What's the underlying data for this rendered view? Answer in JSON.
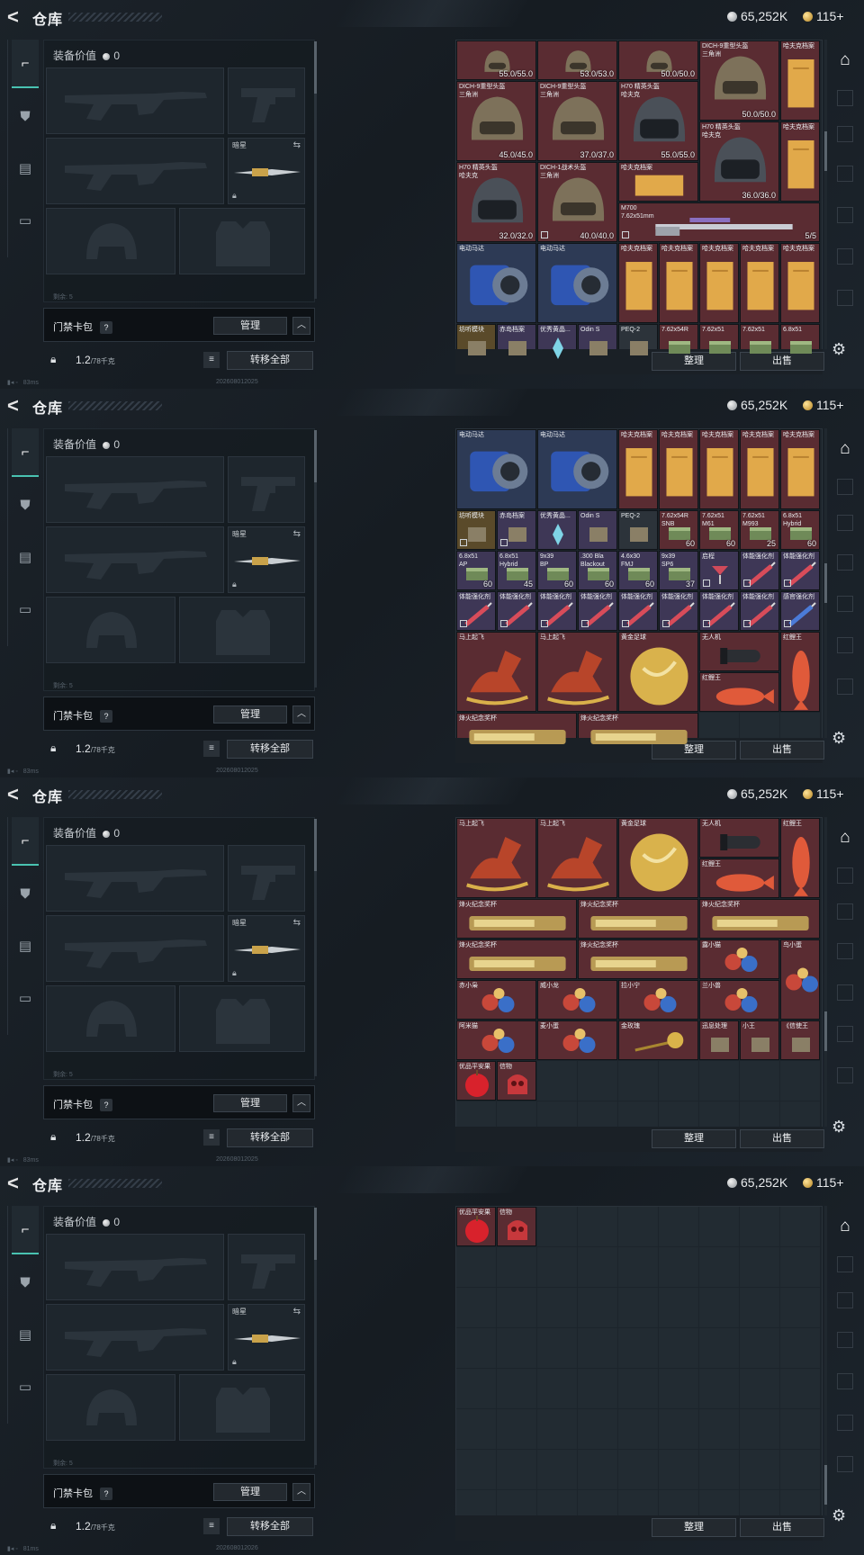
{
  "header": {
    "back_icon": "back-arrow-icon",
    "title": "仓库",
    "silver": "65,252K",
    "gold": "115+"
  },
  "sidebar_tabs": [
    {
      "icon": "gun-icon",
      "glyph": "⌐",
      "active": true
    },
    {
      "icon": "armor-icon",
      "glyph": "⛊",
      "active": false
    },
    {
      "icon": "clipboard-icon",
      "glyph": "▤",
      "active": false
    },
    {
      "icon": "briefcase-icon",
      "glyph": "▭",
      "active": false
    }
  ],
  "equipment": {
    "value_label": "装备价值",
    "value": "0",
    "melee_label": "暗星",
    "row_hint": "剩余: 5"
  },
  "bag": {
    "name": "门禁卡包",
    "help": "?",
    "manage": "管理",
    "caret": "^"
  },
  "footer": {
    "weight": "1.2",
    "weight_max": "/78千克",
    "list_icon": "≡",
    "move_all": "转移全部",
    "sort": "整理",
    "sell": "出售"
  },
  "status_panels": [
    {
      "ping": "83ms",
      "build": "202608012025"
    },
    {
      "ping": "83ms",
      "build": "202608012025"
    },
    {
      "ping": "83ms",
      "build": "202608012025"
    },
    {
      "ping": "81ms",
      "build": "202608012026"
    }
  ],
  "scroll_positions": [
    0.34,
    0.5,
    0.72,
    0.96
  ],
  "stash_views": [
    [
      {
        "c": 1,
        "r": 1,
        "w": 2,
        "h": 1,
        "name": "",
        "qty": "55.0/55.0",
        "rar": "r-red",
        "icon": "helmet"
      },
      {
        "c": 3,
        "r": 1,
        "w": 2,
        "h": 1,
        "name": "",
        "qty": "53.0/53.0",
        "rar": "r-red",
        "icon": "helmet"
      },
      {
        "c": 5,
        "r": 1,
        "w": 2,
        "h": 1,
        "name": "",
        "qty": "50.0/50.0",
        "rar": "r-red",
        "icon": "helmet"
      },
      {
        "c": 7,
        "r": 1,
        "w": 2,
        "h": 2,
        "name": "DICH-9重型头盔\n三角洲",
        "qty": "50.0/50.0",
        "rar": "r-red",
        "icon": "helmet"
      },
      {
        "c": 9,
        "r": 1,
        "w": 1,
        "h": 2,
        "name": "哈夫克档案",
        "qty": "",
        "rar": "r-red",
        "icon": "doc"
      },
      {
        "c": 1,
        "r": 2,
        "w": 2,
        "h": 2,
        "name": "DICH-9重型头盔\n三角洲",
        "qty": "45.0/45.0",
        "rar": "r-red",
        "icon": "helmet"
      },
      {
        "c": 3,
        "r": 2,
        "w": 2,
        "h": 2,
        "name": "DICH-9重型头盔\n三角洲",
        "qty": "37.0/37.0",
        "rar": "r-red",
        "icon": "helmet"
      },
      {
        "c": 5,
        "r": 2,
        "w": 2,
        "h": 2,
        "name": "H70 精英头盔\n哈夫克",
        "qty": "55.0/55.0",
        "rar": "r-red",
        "icon": "helmet-dark"
      },
      {
        "c": 7,
        "r": 3,
        "w": 2,
        "h": 2,
        "name": "H70 精英头盔\n哈夫克",
        "qty": "36.0/36.0",
        "rar": "r-red",
        "icon": "helmet-dark"
      },
      {
        "c": 9,
        "r": 3,
        "w": 1,
        "h": 2,
        "name": "哈夫克档案",
        "qty": "",
        "rar": "r-red",
        "icon": "doc"
      },
      {
        "c": 1,
        "r": 4,
        "w": 2,
        "h": 2,
        "name": "H70 精英头盔\n哈夫克",
        "qty": "32.0/32.0",
        "rar": "r-red",
        "icon": "helmet-dark"
      },
      {
        "c": 3,
        "r": 4,
        "w": 2,
        "h": 2,
        "name": "DICH-1战术头盔\n三角洲",
        "qty": "40.0/40.0",
        "rar": "r-red",
        "icon": "helmet",
        "mark": true
      },
      {
        "c": 5,
        "r": 4,
        "w": 2,
        "h": 1,
        "name": "哈夫克档案",
        "qty": "",
        "rar": "r-red",
        "icon": "doc-wide"
      },
      {
        "c": 5,
        "r": 5,
        "w": 5,
        "h": 1,
        "name": "M700\n7.62x51mm",
        "qty": "5/5",
        "rar": "r-red",
        "icon": "rifle",
        "mark": true
      },
      {
        "c": 1,
        "r": 6,
        "w": 2,
        "h": 2,
        "name": "电动马达",
        "qty": "",
        "rar": "r-blue",
        "icon": "motor"
      },
      {
        "c": 3,
        "r": 6,
        "w": 2,
        "h": 2,
        "name": "电动马达",
        "qty": "",
        "rar": "r-blue",
        "icon": "motor"
      },
      {
        "c": 5,
        "r": 6,
        "w": 1,
        "h": 2,
        "name": "哈夫克档案",
        "qty": "",
        "rar": "r-red",
        "icon": "doc"
      },
      {
        "c": 6,
        "r": 6,
        "w": 1,
        "h": 2,
        "name": "哈夫克档案",
        "qty": "",
        "rar": "r-red",
        "icon": "doc"
      },
      {
        "c": 7,
        "r": 6,
        "w": 1,
        "h": 2,
        "name": "哈夫克档案",
        "qty": "",
        "rar": "r-red",
        "icon": "doc"
      },
      {
        "c": 8,
        "r": 6,
        "w": 1,
        "h": 2,
        "name": "哈夫克档案",
        "qty": "",
        "rar": "r-red",
        "icon": "doc"
      },
      {
        "c": 9,
        "r": 6,
        "w": 1,
        "h": 2,
        "name": "哈夫克档案",
        "qty": "",
        "rar": "r-red",
        "icon": "doc"
      },
      {
        "c": 1,
        "r": 8,
        "w": 1,
        "h": 1,
        "name": "坊听模块",
        "qty": "",
        "rar": "r-gold",
        "icon": "box"
      },
      {
        "c": 2,
        "r": 8,
        "w": 1,
        "h": 1,
        "name": "赤岛档案",
        "qty": "",
        "rar": "r-purple",
        "icon": "box"
      },
      {
        "c": 3,
        "r": 8,
        "w": 1,
        "h": 1,
        "name": "优秀黄晶...",
        "qty": "",
        "rar": "r-purple",
        "icon": "crystal"
      },
      {
        "c": 4,
        "r": 8,
        "w": 1,
        "h": 1,
        "name": "Odin S",
        "qty": "",
        "rar": "r-purple",
        "icon": "box"
      },
      {
        "c": 5,
        "r": 8,
        "w": 1,
        "h": 1,
        "name": "PEQ-2",
        "qty": "",
        "rar": "r-gray",
        "icon": "box"
      },
      {
        "c": 6,
        "r": 8,
        "w": 1,
        "h": 1,
        "name": "7.62x54R",
        "qty": "",
        "rar": "r-red",
        "icon": "ammo"
      },
      {
        "c": 7,
        "r": 8,
        "w": 1,
        "h": 1,
        "name": "7.62x51",
        "qty": "",
        "rar": "r-red",
        "icon": "ammo"
      },
      {
        "c": 8,
        "r": 8,
        "w": 1,
        "h": 1,
        "name": "7.62x51",
        "qty": "",
        "rar": "r-red",
        "icon": "ammo"
      },
      {
        "c": 9,
        "r": 8,
        "w": 1,
        "h": 1,
        "name": "6.8x51",
        "qty": "",
        "rar": "r-red",
        "icon": "ammo"
      }
    ],
    [
      {
        "c": 1,
        "r": 1,
        "w": 2,
        "h": 2,
        "name": "电动马达",
        "qty": "",
        "rar": "r-blue",
        "icon": "motor"
      },
      {
        "c": 3,
        "r": 1,
        "w": 2,
        "h": 2,
        "name": "电动马达",
        "qty": "",
        "rar": "r-blue",
        "icon": "motor"
      },
      {
        "c": 5,
        "r": 1,
        "w": 1,
        "h": 2,
        "name": "哈夫克档案",
        "qty": "",
        "rar": "r-red",
        "icon": "doc"
      },
      {
        "c": 6,
        "r": 1,
        "w": 1,
        "h": 2,
        "name": "哈夫克档案",
        "qty": "",
        "rar": "r-red",
        "icon": "doc"
      },
      {
        "c": 7,
        "r": 1,
        "w": 1,
        "h": 2,
        "name": "哈夫克档案",
        "qty": "",
        "rar": "r-red",
        "icon": "doc"
      },
      {
        "c": 8,
        "r": 1,
        "w": 1,
        "h": 2,
        "name": "哈夫克档案",
        "qty": "",
        "rar": "r-red",
        "icon": "doc"
      },
      {
        "c": 9,
        "r": 1,
        "w": 1,
        "h": 2,
        "name": "哈夫克档案",
        "qty": "",
        "rar": "r-red",
        "icon": "doc"
      },
      {
        "c": 1,
        "r": 3,
        "w": 1,
        "h": 1,
        "name": "坊听模块",
        "qty": "",
        "rar": "r-gold",
        "icon": "box",
        "mark": true
      },
      {
        "c": 2,
        "r": 3,
        "w": 1,
        "h": 1,
        "name": "赤岛档案",
        "qty": "",
        "rar": "r-purple",
        "icon": "box",
        "mark": true
      },
      {
        "c": 3,
        "r": 3,
        "w": 1,
        "h": 1,
        "name": "优秀黄晶...",
        "qty": "",
        "rar": "r-purple",
        "icon": "crystal"
      },
      {
        "c": 4,
        "r": 3,
        "w": 1,
        "h": 1,
        "name": "Odin S",
        "qty": "",
        "rar": "r-purple",
        "icon": "box"
      },
      {
        "c": 5,
        "r": 3,
        "w": 1,
        "h": 1,
        "name": "PEQ-2",
        "qty": "",
        "rar": "r-gray",
        "icon": "box"
      },
      {
        "c": 6,
        "r": 3,
        "w": 1,
        "h": 1,
        "name": "7.62x54R\nSNB",
        "qty": "60",
        "rar": "r-red",
        "icon": "ammo"
      },
      {
        "c": 7,
        "r": 3,
        "w": 1,
        "h": 1,
        "name": "7.62x51\nM61",
        "qty": "60",
        "rar": "r-red",
        "icon": "ammo"
      },
      {
        "c": 8,
        "r": 3,
        "w": 1,
        "h": 1,
        "name": "7.62x51\nM993",
        "qty": "25",
        "rar": "r-red",
        "icon": "ammo"
      },
      {
        "c": 9,
        "r": 3,
        "w": 1,
        "h": 1,
        "name": "6.8x51\nHybrid",
        "qty": "60",
        "rar": "r-red",
        "icon": "ammo"
      },
      {
        "c": 1,
        "r": 4,
        "w": 1,
        "h": 1,
        "name": "6.8x51\nAP",
        "qty": "60",
        "rar": "r-purple",
        "icon": "ammo"
      },
      {
        "c": 2,
        "r": 4,
        "w": 1,
        "h": 1,
        "name": "6.8x51\nHybrid",
        "qty": "45",
        "rar": "r-purple",
        "icon": "ammo"
      },
      {
        "c": 3,
        "r": 4,
        "w": 1,
        "h": 1,
        "name": "9x39\nBP",
        "qty": "60",
        "rar": "r-purple",
        "icon": "ammo"
      },
      {
        "c": 4,
        "r": 4,
        "w": 1,
        "h": 1,
        "name": ".300 Bla\nBlackout",
        "qty": "60",
        "rar": "r-purple",
        "icon": "ammo"
      },
      {
        "c": 5,
        "r": 4,
        "w": 1,
        "h": 1,
        "name": "4.6x30\nFMJ",
        "qty": "60",
        "rar": "r-purple",
        "icon": "ammo"
      },
      {
        "c": 6,
        "r": 4,
        "w": 1,
        "h": 1,
        "name": "9x39\nSP6",
        "qty": "37",
        "rar": "r-purple",
        "icon": "ammo"
      },
      {
        "c": 7,
        "r": 4,
        "w": 1,
        "h": 1,
        "name": "启程",
        "qty": "",
        "rar": "r-purple",
        "icon": "glass",
        "mark": true
      },
      {
        "c": 8,
        "r": 4,
        "w": 1,
        "h": 1,
        "name": "体能强化剂",
        "qty": "",
        "rar": "r-purple",
        "icon": "syringe",
        "mark": true
      },
      {
        "c": 9,
        "r": 4,
        "w": 1,
        "h": 1,
        "name": "体能强化剂",
        "qty": "",
        "rar": "r-purple",
        "icon": "syringe",
        "mark": true
      },
      {
        "c": 1,
        "r": 5,
        "w": 1,
        "h": 1,
        "name": "体能强化剂",
        "qty": "",
        "rar": "r-purple",
        "icon": "syringe",
        "mark": true
      },
      {
        "c": 2,
        "r": 5,
        "w": 1,
        "h": 1,
        "name": "体能强化剂",
        "qty": "",
        "rar": "r-purple",
        "icon": "syringe",
        "mark": true
      },
      {
        "c": 3,
        "r": 5,
        "w": 1,
        "h": 1,
        "name": "体能强化剂",
        "qty": "",
        "rar": "r-purple",
        "icon": "syringe",
        "mark": true
      },
      {
        "c": 4,
        "r": 5,
        "w": 1,
        "h": 1,
        "name": "体能强化剂",
        "qty": "",
        "rar": "r-purple",
        "icon": "syringe",
        "mark": true
      },
      {
        "c": 5,
        "r": 5,
        "w": 1,
        "h": 1,
        "name": "体能强化剂",
        "qty": "",
        "rar": "r-purple",
        "icon": "syringe",
        "mark": true
      },
      {
        "c": 6,
        "r": 5,
        "w": 1,
        "h": 1,
        "name": "体能强化剂",
        "qty": "",
        "rar": "r-purple",
        "icon": "syringe",
        "mark": true
      },
      {
        "c": 7,
        "r": 5,
        "w": 1,
        "h": 1,
        "name": "体能强化剂",
        "qty": "",
        "rar": "r-purple",
        "icon": "syringe",
        "mark": true
      },
      {
        "c": 8,
        "r": 5,
        "w": 1,
        "h": 1,
        "name": "体能强化剂",
        "qty": "",
        "rar": "r-purple",
        "icon": "syringe",
        "mark": true
      },
      {
        "c": 9,
        "r": 5,
        "w": 1,
        "h": 1,
        "name": "感官强化剂",
        "qty": "",
        "rar": "r-purple",
        "icon": "syringe-blue",
        "mark": true
      },
      {
        "c": 1,
        "r": 6,
        "w": 2,
        "h": 2,
        "name": "马上起飞",
        "qty": "",
        "rar": "r-red",
        "icon": "horse"
      },
      {
        "c": 3,
        "r": 6,
        "w": 2,
        "h": 2,
        "name": "马上起飞",
        "qty": "",
        "rar": "r-red",
        "icon": "horse"
      },
      {
        "c": 5,
        "r": 6,
        "w": 2,
        "h": 2,
        "name": "黄金足球",
        "qty": "",
        "rar": "r-red",
        "icon": "ball"
      },
      {
        "c": 7,
        "r": 6,
        "w": 2,
        "h": 1,
        "name": "无人机",
        "qty": "",
        "rar": "r-red",
        "icon": "drone"
      },
      {
        "c": 9,
        "r": 6,
        "w": 1,
        "h": 2,
        "name": "红鲤王",
        "qty": "",
        "rar": "r-red",
        "icon": "fish-v"
      },
      {
        "c": 7,
        "r": 7,
        "w": 2,
        "h": 1,
        "name": "红鲤王",
        "qty": "",
        "rar": "r-red",
        "icon": "fish"
      },
      {
        "c": 1,
        "r": 8,
        "w": 3,
        "h": 1,
        "name": "烽火纪念奖杯",
        "qty": "",
        "rar": "r-red",
        "icon": "trophy"
      },
      {
        "c": 4,
        "r": 8,
        "w": 3,
        "h": 1,
        "name": "烽火纪念奖杯",
        "qty": "",
        "rar": "r-red",
        "icon": "trophy"
      }
    ],
    [
      {
        "c": 1,
        "r": 1,
        "w": 2,
        "h": 2,
        "name": "马上起飞",
        "qty": "",
        "rar": "r-red",
        "icon": "horse"
      },
      {
        "c": 3,
        "r": 1,
        "w": 2,
        "h": 2,
        "name": "马上起飞",
        "qty": "",
        "rar": "r-red",
        "icon": "horse"
      },
      {
        "c": 5,
        "r": 1,
        "w": 2,
        "h": 2,
        "name": "黄金足球",
        "qty": "",
        "rar": "r-red",
        "icon": "ball"
      },
      {
        "c": 7,
        "r": 1,
        "w": 2,
        "h": 1,
        "name": "无人机",
        "qty": "",
        "rar": "r-red",
        "icon": "drone"
      },
      {
        "c": 9,
        "r": 1,
        "w": 1,
        "h": 2,
        "name": "红鲤王",
        "qty": "",
        "rar": "r-red",
        "icon": "fish-v"
      },
      {
        "c": 7,
        "r": 2,
        "w": 2,
        "h": 1,
        "name": "红鲤王",
        "qty": "",
        "rar": "r-red",
        "icon": "fish"
      },
      {
        "c": 1,
        "r": 3,
        "w": 3,
        "h": 1,
        "name": "烽火纪念奖杯",
        "qty": "",
        "rar": "r-red",
        "icon": "trophy"
      },
      {
        "c": 4,
        "r": 3,
        "w": 3,
        "h": 1,
        "name": "烽火纪念奖杯",
        "qty": "",
        "rar": "r-red",
        "icon": "trophy"
      },
      {
        "c": 7,
        "r": 3,
        "w": 3,
        "h": 1,
        "name": "烽火纪念奖杯",
        "qty": "",
        "rar": "r-red",
        "icon": "trophy"
      },
      {
        "c": 1,
        "r": 4,
        "w": 3,
        "h": 1,
        "name": "烽火纪念奖杯",
        "qty": "",
        "rar": "r-red",
        "icon": "trophy"
      },
      {
        "c": 4,
        "r": 4,
        "w": 3,
        "h": 1,
        "name": "烽火纪念奖杯",
        "qty": "",
        "rar": "r-red",
        "icon": "trophy"
      },
      {
        "c": 7,
        "r": 4,
        "w": 2,
        "h": 1,
        "name": "露小猫",
        "qty": "",
        "rar": "r-red",
        "icon": "toy"
      },
      {
        "c": 9,
        "r": 4,
        "w": 1,
        "h": 2,
        "name": "鸟小蛋",
        "qty": "",
        "rar": "r-red",
        "icon": "toy"
      },
      {
        "c": 1,
        "r": 5,
        "w": 2,
        "h": 1,
        "name": "赤小枭",
        "qty": "",
        "rar": "r-red",
        "icon": "toy"
      },
      {
        "c": 3,
        "r": 5,
        "w": 2,
        "h": 1,
        "name": "威小龙",
        "qty": "",
        "rar": "r-red",
        "icon": "toy"
      },
      {
        "c": 5,
        "r": 5,
        "w": 2,
        "h": 1,
        "name": "拉小宁",
        "qty": "",
        "rar": "r-red",
        "icon": "toy"
      },
      {
        "c": 7,
        "r": 5,
        "w": 2,
        "h": 1,
        "name": "兰小兽",
        "qty": "",
        "rar": "r-red",
        "icon": "toy"
      },
      {
        "c": 1,
        "r": 6,
        "w": 2,
        "h": 1,
        "name": "阿米猫",
        "qty": "",
        "rar": "r-red",
        "icon": "toy"
      },
      {
        "c": 3,
        "r": 6,
        "w": 2,
        "h": 1,
        "name": "麦小蛋",
        "qty": "",
        "rar": "r-red",
        "icon": "toy"
      },
      {
        "c": 5,
        "r": 6,
        "w": 2,
        "h": 1,
        "name": "金玫瑰",
        "qty": "",
        "rar": "r-red",
        "icon": "rose"
      },
      {
        "c": 7,
        "r": 6,
        "w": 1,
        "h": 1,
        "name": "迅息处理",
        "qty": "",
        "rar": "r-red",
        "icon": "box"
      },
      {
        "c": 8,
        "r": 6,
        "w": 1,
        "h": 1,
        "name": "小王",
        "qty": "",
        "rar": "r-red",
        "icon": "box"
      },
      {
        "c": 9,
        "r": 6,
        "w": 1,
        "h": 1,
        "name": "《信使王",
        "qty": "",
        "rar": "r-red",
        "icon": "box"
      },
      {
        "c": 1,
        "r": 7,
        "w": 1,
        "h": 1,
        "name": "优品平安果",
        "qty": "",
        "rar": "r-red",
        "icon": "apple"
      },
      {
        "c": 2,
        "r": 7,
        "w": 1,
        "h": 1,
        "name": "信物",
        "qty": "",
        "rar": "r-red",
        "icon": "skull"
      }
    ],
    [
      {
        "c": 1,
        "r": 1,
        "w": 1,
        "h": 1,
        "name": "优品平安果",
        "qty": "",
        "rar": "r-red",
        "icon": "apple"
      },
      {
        "c": 2,
        "r": 1,
        "w": 1,
        "h": 1,
        "name": "信物",
        "qty": "",
        "rar": "r-red",
        "icon": "skull"
      }
    ]
  ]
}
